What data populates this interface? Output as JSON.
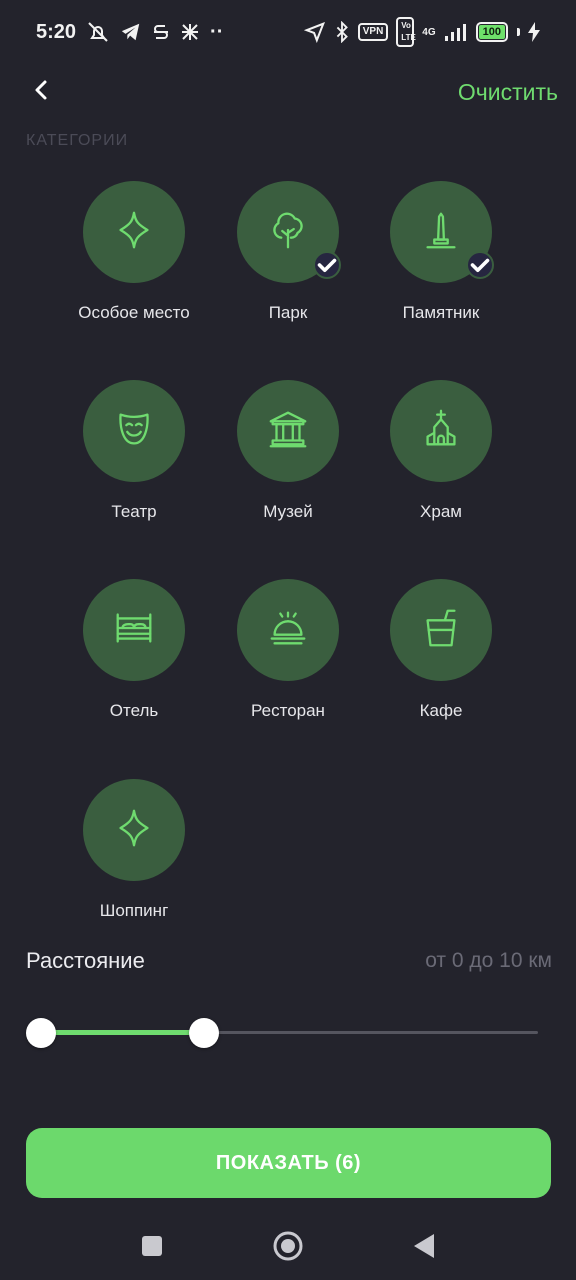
{
  "status_bar": {
    "time": "5:20",
    "vpn": "VPN",
    "volte": "Vo LTE",
    "network": "4G",
    "battery": "100",
    "more": "··"
  },
  "header": {
    "back_icon": "chevron-left-icon",
    "clear_label": "Очистить"
  },
  "section_label": "КАТЕГОРИИ",
  "categories": [
    {
      "label": "Особое место",
      "icon": "sparkle-icon",
      "selected": false
    },
    {
      "label": "Парк",
      "icon": "tree-icon",
      "selected": true
    },
    {
      "label": "Памятник",
      "icon": "monument-icon",
      "selected": true
    },
    {
      "label": "Театр",
      "icon": "theater-mask-icon",
      "selected": false
    },
    {
      "label": "Музей",
      "icon": "museum-icon",
      "selected": false
    },
    {
      "label": "Храм",
      "icon": "church-icon",
      "selected": false
    },
    {
      "label": "Отель",
      "icon": "bed-icon",
      "selected": false
    },
    {
      "label": "Ресторан",
      "icon": "cloche-icon",
      "selected": false
    },
    {
      "label": "Кафе",
      "icon": "drink-cup-icon",
      "selected": false
    },
    {
      "label": "Шоппинг",
      "icon": "sparkle-icon",
      "selected": false
    }
  ],
  "distance": {
    "title": "Расстояние",
    "value_text": "от 0 до 10 км",
    "range_min_fraction": 0,
    "range_max_fraction": 0.33
  },
  "show_button_label": "ПОКАЗАТЬ (6)",
  "colors": {
    "accent": "#6fdb6f",
    "background": "#23232c",
    "category_circle": "#3a5e3f"
  }
}
